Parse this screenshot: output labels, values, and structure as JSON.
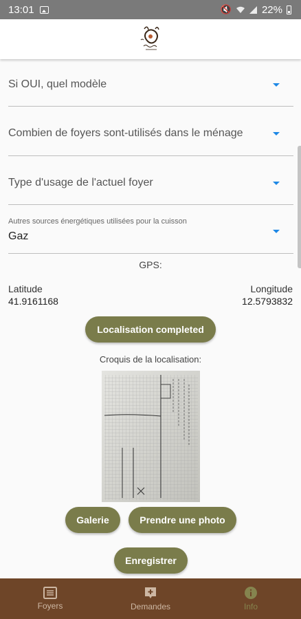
{
  "status_bar": {
    "time": "13:01",
    "battery": "22%",
    "icons": [
      "gallery-icon",
      "mute-icon",
      "wifi-icon",
      "signal-icon",
      "battery-icon"
    ]
  },
  "app_bar": {
    "logo": "brand-logo"
  },
  "form": {
    "modele_label": "Si OUI, quel modèle",
    "foyers_label": "Combien de foyers sont-utilisés dans le ménage",
    "usage_label": "Type d'usage de l'actuel foyer",
    "sources_label": "Autres sources énergétiques utilisées pour la cuisson",
    "sources_value": "Gaz"
  },
  "gps": {
    "title": "GPS:",
    "latitude_label": "Latitude",
    "latitude_value": "41.9161168",
    "longitude_label": "Longitude",
    "longitude_value": "12.5793832",
    "status_button": "Localisation completed"
  },
  "croquis": {
    "title": "Croquis de la localisation:",
    "gallery_button": "Galerie",
    "photo_button": "Prendre une photo"
  },
  "save_button": "Enregistrer",
  "bottom_nav": {
    "items": [
      {
        "label": "Foyers",
        "icon": "list-icon"
      },
      {
        "label": "Demandes",
        "icon": "add-box-icon"
      },
      {
        "label": "Info",
        "icon": "info-icon",
        "active": true
      }
    ]
  },
  "colors": {
    "button": "#7a7c4b",
    "dropdown_arrow": "#1e88e5",
    "bottom_nav": "#6e4528",
    "active_tab": "#85844e"
  }
}
